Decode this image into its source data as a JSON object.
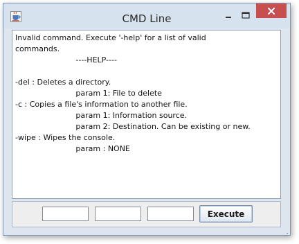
{
  "window": {
    "title": "CMD Line"
  },
  "console": {
    "lines": [
      "Invalid command. Execute '-help' for a list of valid",
      "commands.",
      "                         ----HELP----",
      "",
      "-del : Deletes a directory.",
      "                         param 1: File to delete",
      "-c : Copies a file's information to another file.",
      "                         param 1: Information source.",
      "                         param 2: Destination. Can be existing or new.",
      "-wipe : Wipes the console.",
      "                         param : NONE"
    ]
  },
  "inputs": [
    {
      "value": "",
      "placeholder": ""
    },
    {
      "value": "",
      "placeholder": ""
    },
    {
      "value": "",
      "placeholder": ""
    }
  ],
  "buttons": {
    "execute_label": "Execute"
  },
  "icons": {
    "app": "java-cup-icon",
    "minimize": "minimize-icon",
    "maximize": "maximize-icon",
    "close": "close-icon"
  },
  "colors": {
    "titlebar": "#d6e2ee",
    "close_button": "#c74f4f"
  }
}
